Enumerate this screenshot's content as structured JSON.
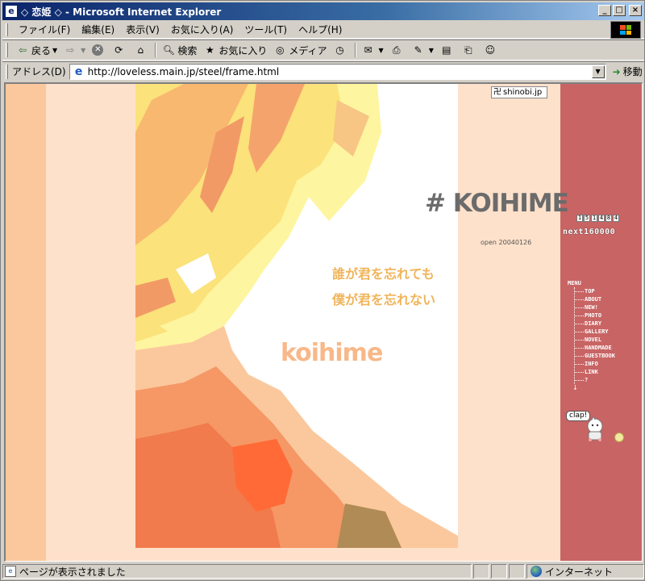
{
  "window": {
    "title": "◇ 恋姫 ◇ - Microsoft Internet Explorer",
    "icon": "ie-page-icon",
    "buttons": {
      "minimize": "_",
      "maximize": "□",
      "close": "×"
    }
  },
  "menubar": {
    "items": [
      "ファイル(F)",
      "編集(E)",
      "表示(V)",
      "お気に入り(A)",
      "ツール(T)",
      "ヘルプ(H)"
    ]
  },
  "toolbar": {
    "back": "戻る",
    "search": "検索",
    "favorites": "お気に入り",
    "media": "メディア"
  },
  "addressbar": {
    "label": "アドレス(D)",
    "url": "http://loveless.main.jp/steel/frame.html",
    "go": "移動"
  },
  "page": {
    "shinobi": "shinobi.jp",
    "title": "# KOIHIME",
    "open_date": "open 20040126",
    "poem_line1": "誰が君を忘れても",
    "poem_line2": "僕が君を忘れない",
    "logo_text": "koihime",
    "counter_digits": [
      "1",
      "5",
      "1",
      "4",
      "8",
      "4"
    ],
    "next_counter": "next160000",
    "menu_title": "MENU",
    "menu_items": [
      "TOP",
      "ABOUT",
      "NEW!",
      "PHOTO",
      "DIARY",
      "GALLERY",
      "NOVEL",
      "HANDMADE",
      "GUESTBOOK",
      "INFO",
      "LINK",
      "?"
    ],
    "clap_label": "clap!",
    "colors": {
      "background": "#fee1cb",
      "left_stripe": "#fbc89d",
      "right_panel": "#c86464",
      "title": "#6b6b6b",
      "poem": "#f0b45a",
      "logo": "#f8b888"
    }
  },
  "statusbar": {
    "text": "ページが表示されました",
    "zone": "インターネット"
  }
}
